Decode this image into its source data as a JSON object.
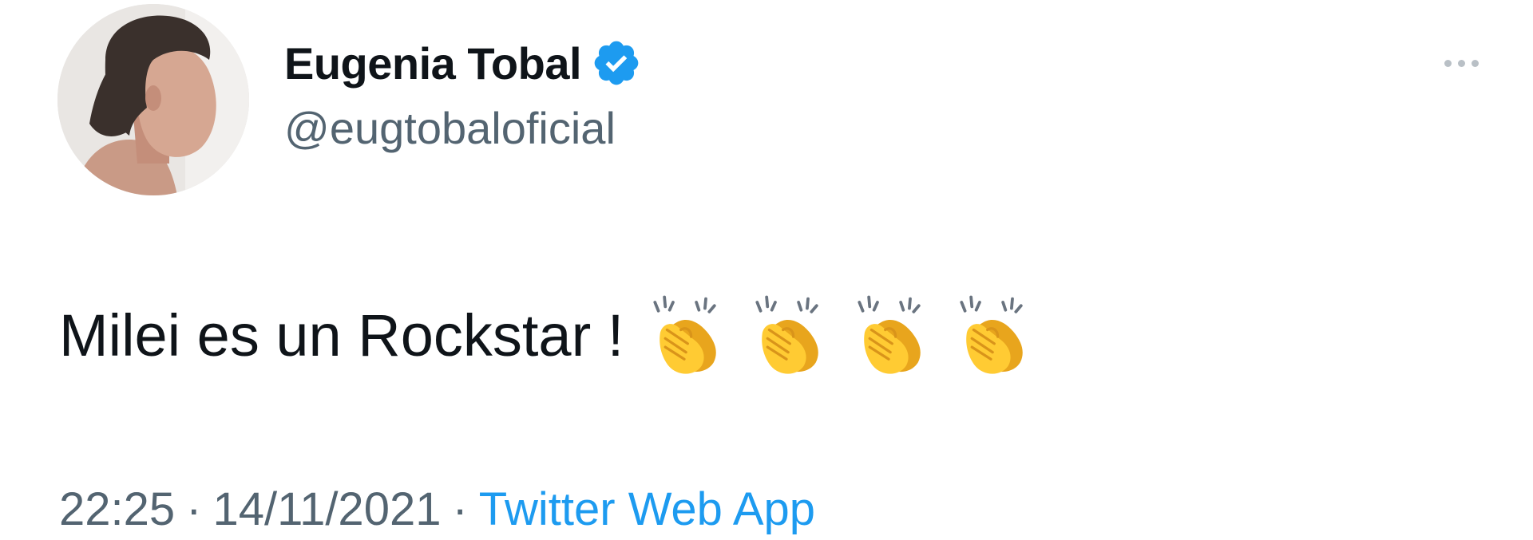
{
  "tweet": {
    "author": {
      "display_name": "Eugenia Tobal",
      "handle": "@eugtobaloficial",
      "verified": true,
      "avatar_icon": "profile-photo"
    },
    "more_icon": "more-horizontal-icon",
    "text": "Milei es un Rockstar !",
    "emojis": [
      "clapping-hands",
      "clapping-hands",
      "clapping-hands",
      "clapping-hands"
    ],
    "time": "22:25",
    "separator": "·",
    "date": "14/11/2021",
    "source": "Twitter Web App"
  },
  "colors": {
    "text_primary": "#0f1419",
    "text_secondary": "#536471",
    "link": "#1d9bf0",
    "verified_badge": "#1d9bf0"
  }
}
